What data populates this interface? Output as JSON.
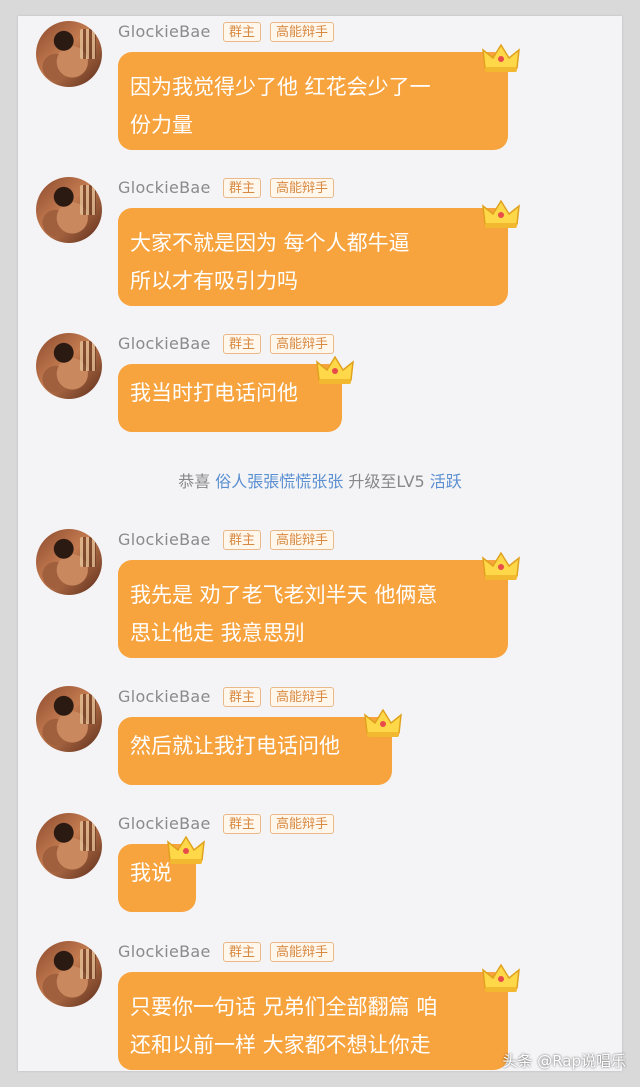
{
  "sender": {
    "name": "GlockieBae",
    "role_badge": "群主",
    "title_badge": "高能辩手"
  },
  "messages": [
    {
      "lines": [
        "因为我觉得少了他 红花会少了一",
        "份力量"
      ]
    },
    {
      "lines": [
        "大家不就是因为 每个人都牛逼",
        "所以才有吸引力吗"
      ]
    },
    {
      "lines": [
        "我当时打电话问他"
      ]
    },
    {
      "lines": [
        "我先是 劝了老飞老刘半天 他俩意",
        "思让他走 我意思别"
      ]
    },
    {
      "lines": [
        "然后就让我打电话问他"
      ]
    },
    {
      "lines": [
        "我说"
      ]
    },
    {
      "lines": [
        "只要你一句话 兄弟们全部翻篇 咱",
        "还和以前一样 大家都不想让你走"
      ]
    }
  ],
  "system_message": {
    "prefix": "恭喜",
    "user": "俗人張張慌慌张张",
    "middle": "升级至LV5",
    "level_tag": "活跃"
  },
  "watermark": "头条 @Rap说唱乐",
  "colors": {
    "bubble": "#f7a33e",
    "badge_text": "#d88a42",
    "link_blue": "#5a8fd1",
    "background": "#f4f4f6"
  },
  "icons": [
    "crown-icon",
    "avatar-image"
  ]
}
